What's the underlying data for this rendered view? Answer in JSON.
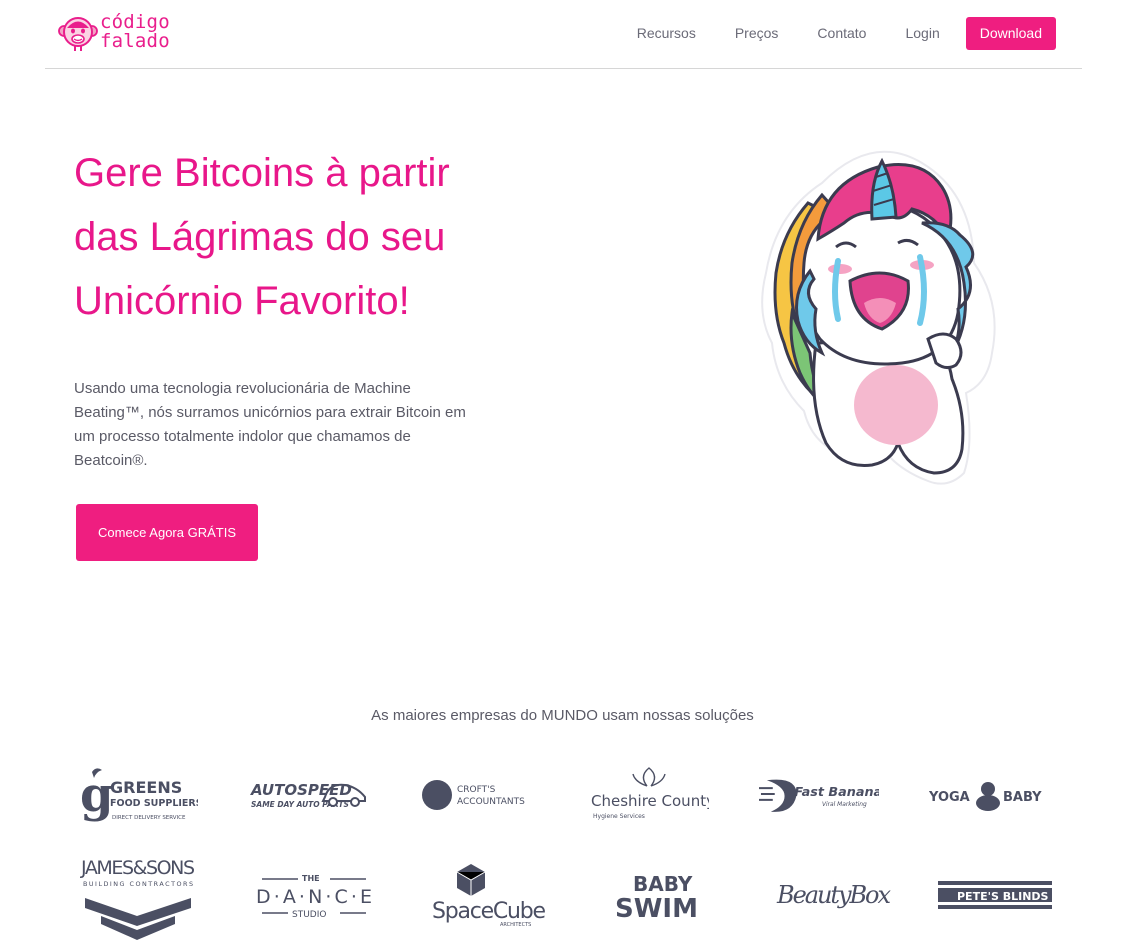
{
  "header": {
    "brand_line1": "código",
    "brand_line2": "falado",
    "nav": [
      "Recursos",
      "Preços",
      "Contato",
      "Login"
    ],
    "download_label": "Download"
  },
  "hero": {
    "title_lines": [
      "Gere Bitcoins à partir",
      "das Lágrimas do seu",
      "Unicórnio Favorito!"
    ],
    "description": "Usando uma tecnologia revolucionária de Machine Beating™, nós surramos unicórnios para extrair Bitcoin em um processo totalmente indolor que chamamos de Beatcoin®.",
    "cta_label": "Comece Agora GRÁTIS"
  },
  "clients": {
    "heading": "As maiores empresas do MUNDO usam nossas soluções",
    "logos": {
      "greens": {
        "main": "GREENS",
        "sub": "FOOD SUPPLIERS",
        "tag": "DIRECT DELIVERY SERVICE"
      },
      "autospeed": {
        "main": "AUTOSPEED",
        "sub": "SAME DAY AUTO PARTS"
      },
      "crofts": {
        "line1": "CROFT'S",
        "line2": "ACCOUNTANTS"
      },
      "cheshire": {
        "main": "Cheshire County",
        "sub": "Hygiene Services"
      },
      "fastbanana": {
        "main": "Fast Banana",
        "sub": "Viral Marketing"
      },
      "yogababy": {
        "left": "YOGA",
        "right": "BABY"
      },
      "jamessons": {
        "main": "JAMES&SONS",
        "sub": "BUILDING CONTRACTORS"
      },
      "dance": {
        "the": "THE",
        "main": "D·A·N·C·E",
        "sub": "STUDIO"
      },
      "spacecube": {
        "main": "SpaceCube",
        "sub": "ARCHITECTS"
      },
      "babyswim": {
        "line1": "BABY",
        "line2": "SWIM"
      },
      "beautybox": {
        "main": "BeautyBox"
      },
      "petes": {
        "main": "PETE'S BLINDS"
      }
    }
  },
  "colors": {
    "brand_pink": "#e8178a",
    "button_pink": "#ef1e80",
    "logo_gray": "#4b4f63",
    "text_gray": "#5a5a66"
  }
}
